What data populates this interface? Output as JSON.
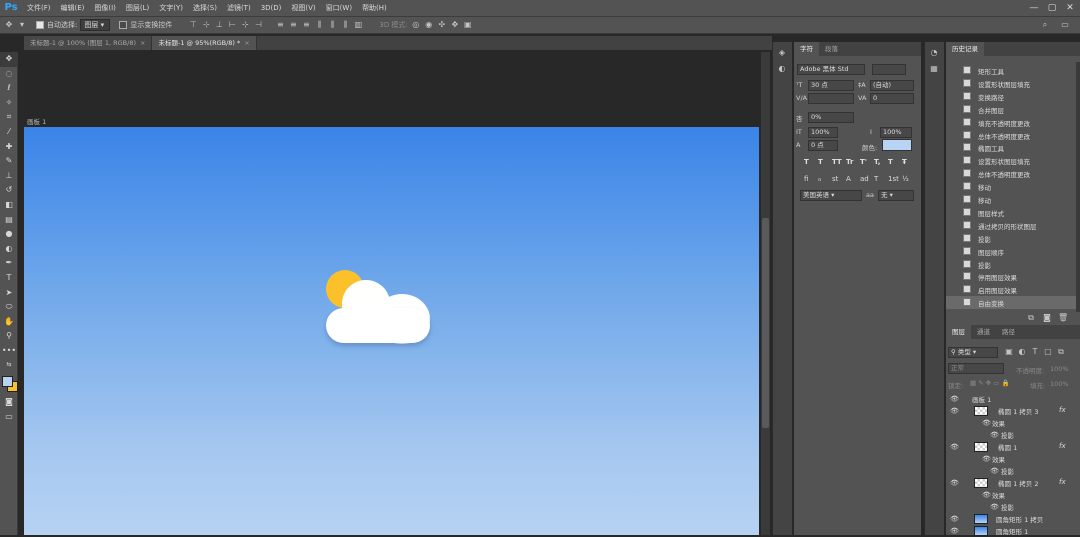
{
  "app": {
    "logo": "Ps"
  },
  "menu": [
    "文件(F)",
    "编辑(E)",
    "图像(I)",
    "图层(L)",
    "文字(Y)",
    "选择(S)",
    "滤镜(T)",
    "3D(D)",
    "视图(V)",
    "窗口(W)",
    "帮助(H)"
  ],
  "window_controls": {
    "minimize": "—",
    "maximize": "▢",
    "close": "✕"
  },
  "options": {
    "auto_select_label": "自动选择:",
    "auto_select_target": "图层",
    "show_transform_label": "显示变换控件",
    "mode_3d_label": "3D 模式:"
  },
  "tabs": [
    {
      "label": "未标题-1 @ 100% (图层 1, RGB/8)",
      "close": "×"
    },
    {
      "label": "未标题-1 @ 95%(RGB/8) *",
      "close": "×"
    }
  ],
  "artboard": {
    "label": "画板 1"
  },
  "character": {
    "tabs": [
      "字符",
      "段落"
    ],
    "font_family": "Adobe 黑体 Std",
    "font_size": "30 点",
    "leading": "(自动)",
    "tracking": "0",
    "scale_pct": "0%",
    "vertical_scale": "100%",
    "horizontal_scale": "100%",
    "baseline": "0 点",
    "color_label": "颜色:",
    "color_value": "#b9d3f5",
    "language": "美国英语",
    "aa_label": "aa",
    "antialias": "无",
    "type_styles": [
      "T",
      "T",
      "TT",
      "Tr",
      "T'",
      "T,",
      "T",
      "Ŧ"
    ],
    "opentype": [
      "fi",
      "ℴ",
      "st",
      "A",
      "ad",
      "T",
      "1st",
      "½"
    ]
  },
  "history": {
    "title": "历史记录",
    "items": [
      "矩形工具",
      "设置形状图层填充",
      "变换路径",
      "合并图层",
      "填充不透明度更改",
      "总体不透明度更改",
      "椭圆工具",
      "设置形状图层填充",
      "总体不透明度更改",
      "移动",
      "移动",
      "图层样式",
      "通过拷贝的形状图层",
      "投影",
      "图层顺序",
      "投影",
      "停用图层效果",
      "启用图层效果",
      "自由变换"
    ]
  },
  "layers_panel": {
    "tabs": [
      "图层",
      "通道",
      "路径"
    ],
    "filter_kind": "类型",
    "blend_mode": "正常",
    "opacity_label": "不透明度:",
    "opacity": "100%",
    "lock_label": "锁定:",
    "fill_label": "填充:",
    "fill": "100%",
    "rows": [
      {
        "name": "画板 1",
        "type": "artboard"
      },
      {
        "name": "椭圆 1 拷贝 3",
        "type": "layer",
        "fx": "fx"
      },
      {
        "name": "效果",
        "type": "effects"
      },
      {
        "name": "投影",
        "type": "effect"
      },
      {
        "name": "椭圆 1",
        "type": "layer",
        "fx": "fx"
      },
      {
        "name": "效果",
        "type": "effects"
      },
      {
        "name": "投影",
        "type": "effect"
      },
      {
        "name": "椭圆 1 拷贝 2",
        "type": "layer",
        "fx": "fx"
      },
      {
        "name": "效果",
        "type": "effects"
      },
      {
        "name": "投影",
        "type": "effect"
      },
      {
        "name": "圆角矩形 1 拷贝",
        "type": "layer"
      },
      {
        "name": "圆角矩形 1",
        "type": "layer"
      }
    ]
  },
  "colors": {
    "foreground": "#b9d3f5",
    "background": "#fcc12a",
    "sun": "#fcc12a",
    "cloud": "#ffffff"
  }
}
